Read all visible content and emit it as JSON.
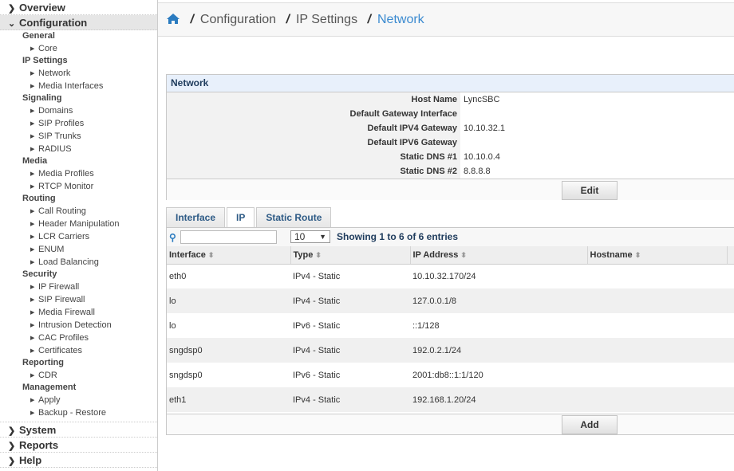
{
  "sidebar": {
    "top": [
      {
        "label": "Overview",
        "expanded": false
      }
    ],
    "configuration": {
      "label": "Configuration",
      "expanded": true,
      "groups": [
        {
          "label": "General",
          "items": [
            "Core"
          ]
        },
        {
          "label": "IP Settings",
          "items": [
            "Network",
            "Media Interfaces"
          ]
        },
        {
          "label": "Signaling",
          "items": [
            "Domains",
            "SIP Profiles",
            "SIP Trunks",
            "RADIUS"
          ]
        },
        {
          "label": "Media",
          "items": [
            "Media Profiles",
            "RTCP Monitor"
          ]
        },
        {
          "label": "Routing",
          "items": [
            "Call Routing",
            "Header Manipulation",
            "LCR Carriers",
            "ENUM",
            "Load Balancing"
          ]
        },
        {
          "label": "Security",
          "items": [
            "IP Firewall",
            "SIP Firewall",
            "Media Firewall",
            "Intrusion Detection",
            "CAC Profiles",
            "Certificates"
          ]
        },
        {
          "label": "Reporting",
          "items": [
            "CDR"
          ]
        },
        {
          "label": "Management",
          "items": [
            "Apply",
            "Backup - Restore"
          ]
        }
      ]
    },
    "bottom": [
      "System",
      "Reports",
      "Help"
    ]
  },
  "breadcrumb": {
    "items": [
      "Configuration",
      "IP Settings"
    ],
    "current": "Network",
    "home_icon": "home-icon"
  },
  "network": {
    "title": "Network",
    "fields": [
      {
        "label": "Host Name",
        "value": "LyncSBC"
      },
      {
        "label": "Default Gateway Interface",
        "value": ""
      },
      {
        "label": "Default IPV4 Gateway",
        "value": "10.10.32.1"
      },
      {
        "label": "Default IPV6 Gateway",
        "value": ""
      },
      {
        "label": "Static DNS #1",
        "value": "10.10.0.4"
      },
      {
        "label": "Static DNS #2",
        "value": "8.8.8.8"
      }
    ],
    "edit_label": "Edit"
  },
  "tabs": [
    {
      "label": "Interface"
    },
    {
      "label": "IP",
      "selected": true
    },
    {
      "label": "Static Route"
    }
  ],
  "table": {
    "search_value": "",
    "page_length": "10",
    "info": "Showing 1 to 6 of 6 entries",
    "columns": [
      "Interface",
      "Type",
      "IP Address",
      "Hostname"
    ],
    "rows": [
      [
        "eth0",
        "IPv4 - Static",
        "10.10.32.170/24",
        ""
      ],
      [
        "lo",
        "IPv4 - Static",
        "127.0.0.1/8",
        ""
      ],
      [
        "lo",
        "IPv6 - Static",
        "::1/128",
        ""
      ],
      [
        "sngdsp0",
        "IPv4 - Static",
        "192.0.2.1/24",
        ""
      ],
      [
        "sngdsp0",
        "IPv6 - Static",
        "2001:db8::1:1/120",
        ""
      ],
      [
        "eth1",
        "IPv4 - Static",
        "192.168.1.20/24",
        ""
      ]
    ],
    "add_label": "Add"
  },
  "colors": {
    "accent": "#3a8ad0",
    "panel_header": "#e8f0fb",
    "header_text": "#1e3b5c"
  }
}
